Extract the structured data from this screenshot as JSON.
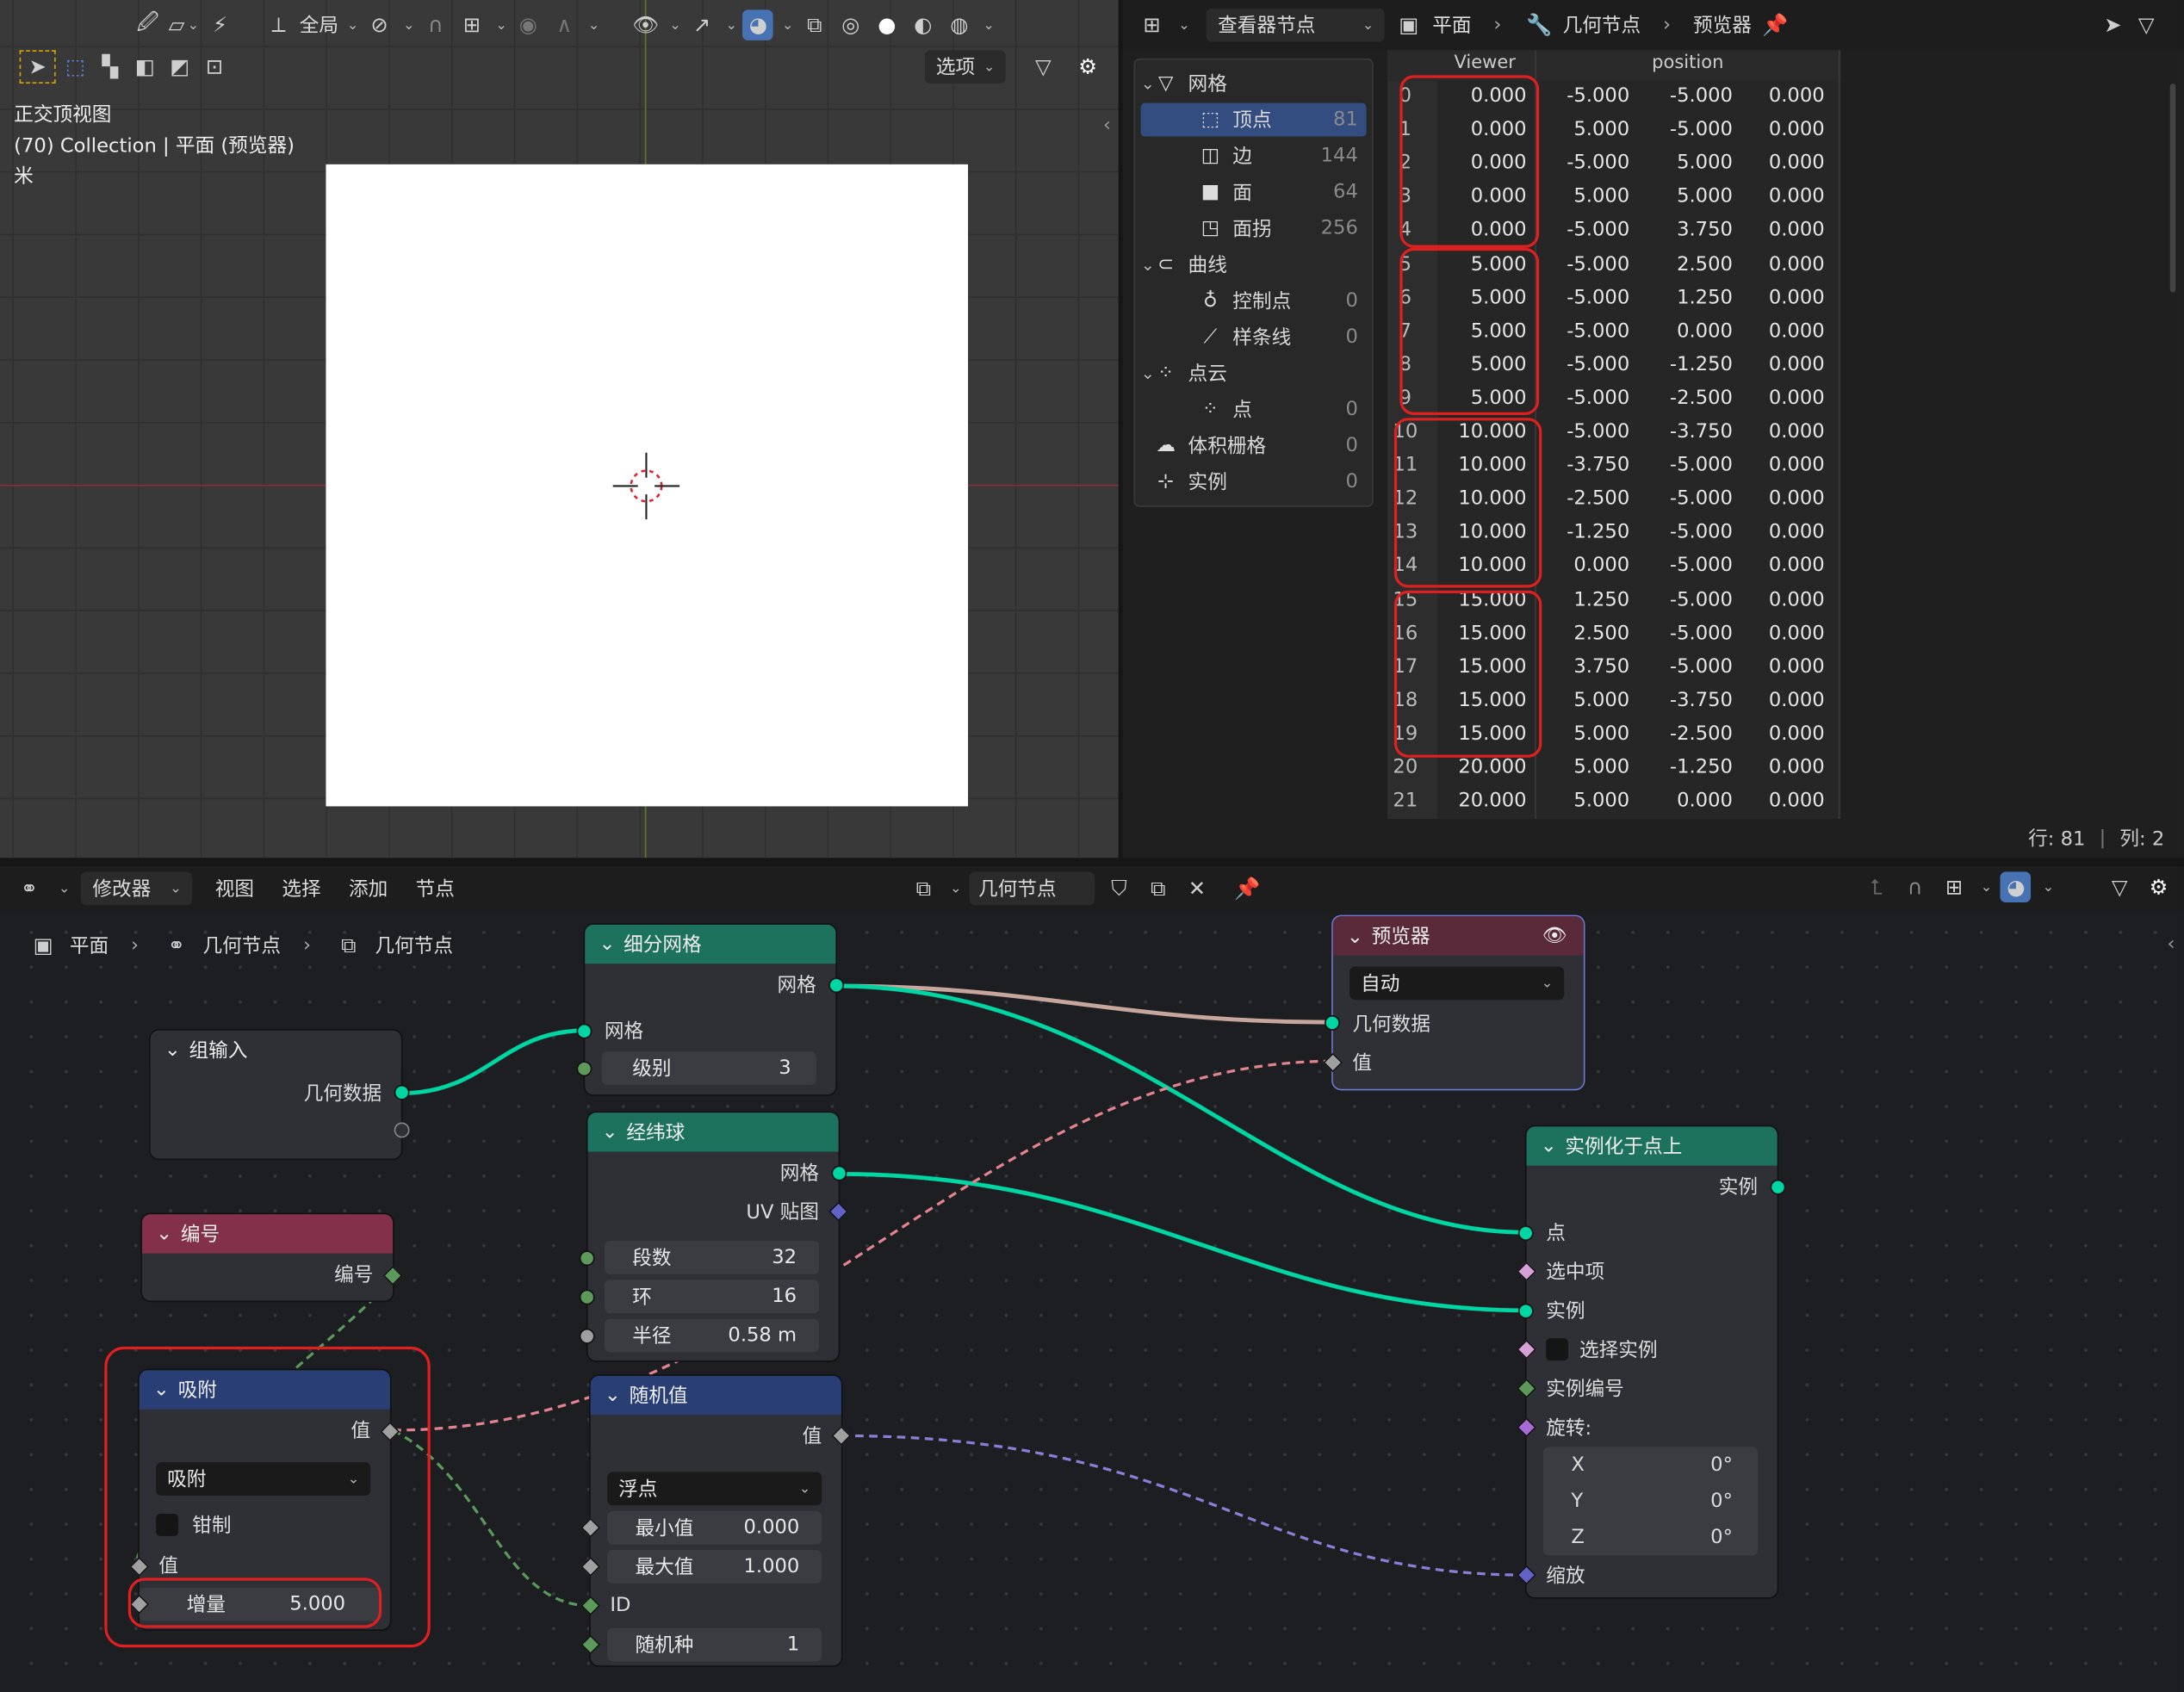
{
  "viewport": {
    "header_global": "全局",
    "options": "选项",
    "overlay_lines": [
      "正交顶视图",
      "(70) Collection | 平面 (预览器)",
      "米"
    ]
  },
  "spreadsheet": {
    "editor_name": "查看器节点",
    "crumb_object": "平面",
    "crumb_modifier": "几何节点",
    "crumb_viewer": "预览器",
    "col_viewer": "Viewer",
    "col_position": "position",
    "tree": [
      {
        "label": "网格",
        "count": "",
        "level": 0
      },
      {
        "label": "顶点",
        "count": "81",
        "level": 1
      },
      {
        "label": "边",
        "count": "144",
        "level": 1
      },
      {
        "label": "面",
        "count": "64",
        "level": 1
      },
      {
        "label": "面拐",
        "count": "256",
        "level": 1
      },
      {
        "label": "曲线",
        "count": "",
        "level": 0
      },
      {
        "label": "控制点",
        "count": "0",
        "level": 1
      },
      {
        "label": "样条线",
        "count": "0",
        "level": 1
      },
      {
        "label": "点云",
        "count": "",
        "level": 0
      },
      {
        "label": "点",
        "count": "0",
        "level": 1
      },
      {
        "label": "体积栅格",
        "count": "0",
        "level": 0
      },
      {
        "label": "实例",
        "count": "0",
        "level": 0
      }
    ],
    "rows": [
      [
        "0",
        "0.000",
        "-5.000",
        "-5.000",
        "0.000"
      ],
      [
        "1",
        "0.000",
        "5.000",
        "-5.000",
        "0.000"
      ],
      [
        "2",
        "0.000",
        "-5.000",
        "5.000",
        "0.000"
      ],
      [
        "3",
        "0.000",
        "5.000",
        "5.000",
        "0.000"
      ],
      [
        "4",
        "0.000",
        "-5.000",
        "3.750",
        "0.000"
      ],
      [
        "5",
        "5.000",
        "-5.000",
        "2.500",
        "0.000"
      ],
      [
        "6",
        "5.000",
        "-5.000",
        "1.250",
        "0.000"
      ],
      [
        "7",
        "5.000",
        "-5.000",
        "0.000",
        "0.000"
      ],
      [
        "8",
        "5.000",
        "-5.000",
        "-1.250",
        "0.000"
      ],
      [
        "9",
        "5.000",
        "-5.000",
        "-2.500",
        "0.000"
      ],
      [
        "10",
        "10.000",
        "-5.000",
        "-3.750",
        "0.000"
      ],
      [
        "11",
        "10.000",
        "-3.750",
        "-5.000",
        "0.000"
      ],
      [
        "12",
        "10.000",
        "-2.500",
        "-5.000",
        "0.000"
      ],
      [
        "13",
        "10.000",
        "-1.250",
        "-5.000",
        "0.000"
      ],
      [
        "14",
        "10.000",
        "0.000",
        "-5.000",
        "0.000"
      ],
      [
        "15",
        "15.000",
        "1.250",
        "-5.000",
        "0.000"
      ],
      [
        "16",
        "15.000",
        "2.500",
        "-5.000",
        "0.000"
      ],
      [
        "17",
        "15.000",
        "3.750",
        "-5.000",
        "0.000"
      ],
      [
        "18",
        "15.000",
        "5.000",
        "-3.750",
        "0.000"
      ],
      [
        "19",
        "15.000",
        "5.000",
        "-2.500",
        "0.000"
      ],
      [
        "20",
        "20.000",
        "5.000",
        "-1.250",
        "0.000"
      ],
      [
        "21",
        "20.000",
        "5.000",
        "0.000",
        "0.000"
      ]
    ],
    "footer_rows": "行: 81",
    "footer_cols": "列: 2"
  },
  "node_editor": {
    "menu": [
      "修改器",
      "视图",
      "选择",
      "添加",
      "节点"
    ],
    "tree_name": "几何节点",
    "breadcrumb": [
      "平面",
      "几何节点",
      "几何节点"
    ],
    "nodes": {
      "group_input": {
        "title": "组输入",
        "out": "几何数据"
      },
      "index": {
        "title": "编号",
        "out": "编号"
      },
      "snap": {
        "title": "吸附",
        "out": "值",
        "mode": "吸附",
        "clamp": "钳制",
        "in": "值",
        "inc_label": "增量",
        "inc_value": "5.000"
      },
      "subdivide": {
        "title": "细分网格",
        "out": "网格",
        "in": "网格",
        "level_label": "级别",
        "level_value": "3"
      },
      "uvsphere": {
        "title": "经纬球",
        "out1": "网格",
        "out2": "UV 贴图",
        "seg_label": "段数",
        "seg_value": "32",
        "ring_label": "环",
        "ring_value": "16",
        "rad_label": "半径",
        "rad_value": "0.58 m"
      },
      "random": {
        "title": "随机值",
        "out": "值",
        "type": "浮点",
        "min_label": "最小值",
        "min_value": "0.000",
        "max_label": "最大值",
        "max_value": "1.000",
        "id": "ID",
        "seed_label": "随机种",
        "seed_value": "1"
      },
      "viewer": {
        "title": "预览器",
        "domain": "自动",
        "in1": "几何数据",
        "in2": "值"
      },
      "instance": {
        "title": "实例化于点上",
        "out": "实例",
        "points": "点",
        "selection": "选中项",
        "instance": "实例",
        "pick": "选择实例",
        "inst_index": "实例编号",
        "rotation": "旋转:",
        "rx": "X",
        "ry": "Y",
        "rz": "Z",
        "rxv": "0°",
        "ryv": "0°",
        "rzv": "0°",
        "scale": "缩放"
      }
    }
  },
  "colors": {
    "accent": "#4772b3",
    "geo_socket": "#00d6a3",
    "node_geo": "#1d725e",
    "node_input": "#83314a",
    "node_util": "#283e75",
    "node_viewer": "#5a2a3a",
    "highlight": "#e02020"
  }
}
